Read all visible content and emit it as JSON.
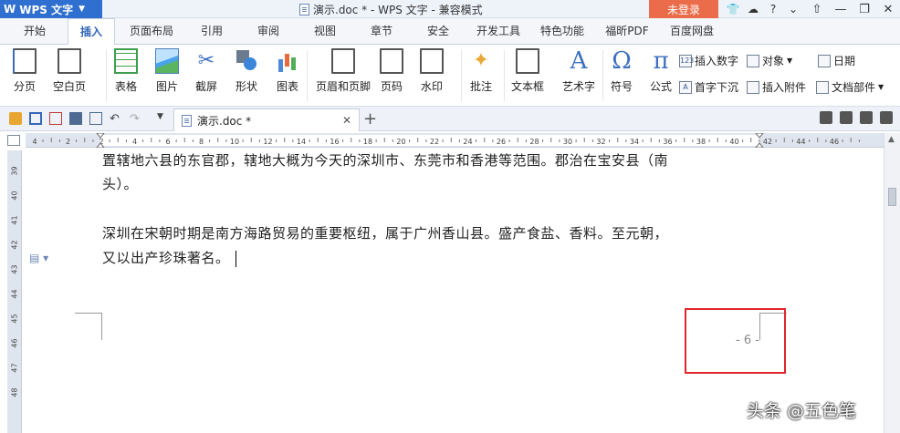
{
  "titlebar": {
    "app_name": "WPS 文字",
    "document_title": "演示.doc * - WPS 文字 - 兼容模式",
    "login_label": "未登录"
  },
  "tabs": [
    "开始",
    "插入",
    "页面布局",
    "引用",
    "审阅",
    "视图",
    "章节",
    "安全",
    "开发工具",
    "特色功能",
    "福昕PDF",
    "百度网盘"
  ],
  "active_tab": "插入",
  "ribbon": {
    "page_break": "分页",
    "blank_page": "空白页",
    "table": "表格",
    "picture": "图片",
    "screenshot": "截屏",
    "shape": "形状",
    "chart": "图表",
    "header_footer": "页眉和页脚",
    "page_number": "页码",
    "watermark": "水印",
    "comment": "批注",
    "textbox": "文本框",
    "wordart": "艺术字",
    "symbol": "符号",
    "formula": "公式",
    "insert_number": "插入数字",
    "dropcap": "首字下沉",
    "object": "对象",
    "attachment": "插入附件",
    "date": "日期",
    "doc_parts": "文档部件",
    "symbol_glyph": "Ω",
    "formula_glyph": "π",
    "wordart_glyph": "A",
    "insert_number_badge": "123"
  },
  "doctab": {
    "name": "演示.doc *"
  },
  "document": {
    "line1": "置辖地六县的东官郡，辖地大概为今天的深圳市、东莞市和香港等范围。郡治在宝安县（南",
    "line2": "头）。",
    "line3": "深圳在宋朝时期是南方海路贸易的重要枢纽，属于广州香山县。盛产食盐、香料。至元朝，",
    "line4": "又以出产珍珠著名。",
    "page_number": "- 6 -"
  },
  "vruler_numbers": [
    "39",
    "40",
    "41",
    "42",
    "43",
    "44",
    "45",
    "46",
    "47",
    "48"
  ],
  "hruler_numbers": [
    "4",
    "2",
    "2",
    "4",
    "6",
    "8",
    "10",
    "12",
    "14",
    "16",
    "18",
    "20",
    "22",
    "24",
    "26",
    "28",
    "30",
    "32",
    "34",
    "36",
    "38",
    "40",
    "42",
    "44",
    "46"
  ],
  "watermark_text": "头条 @五色笔"
}
